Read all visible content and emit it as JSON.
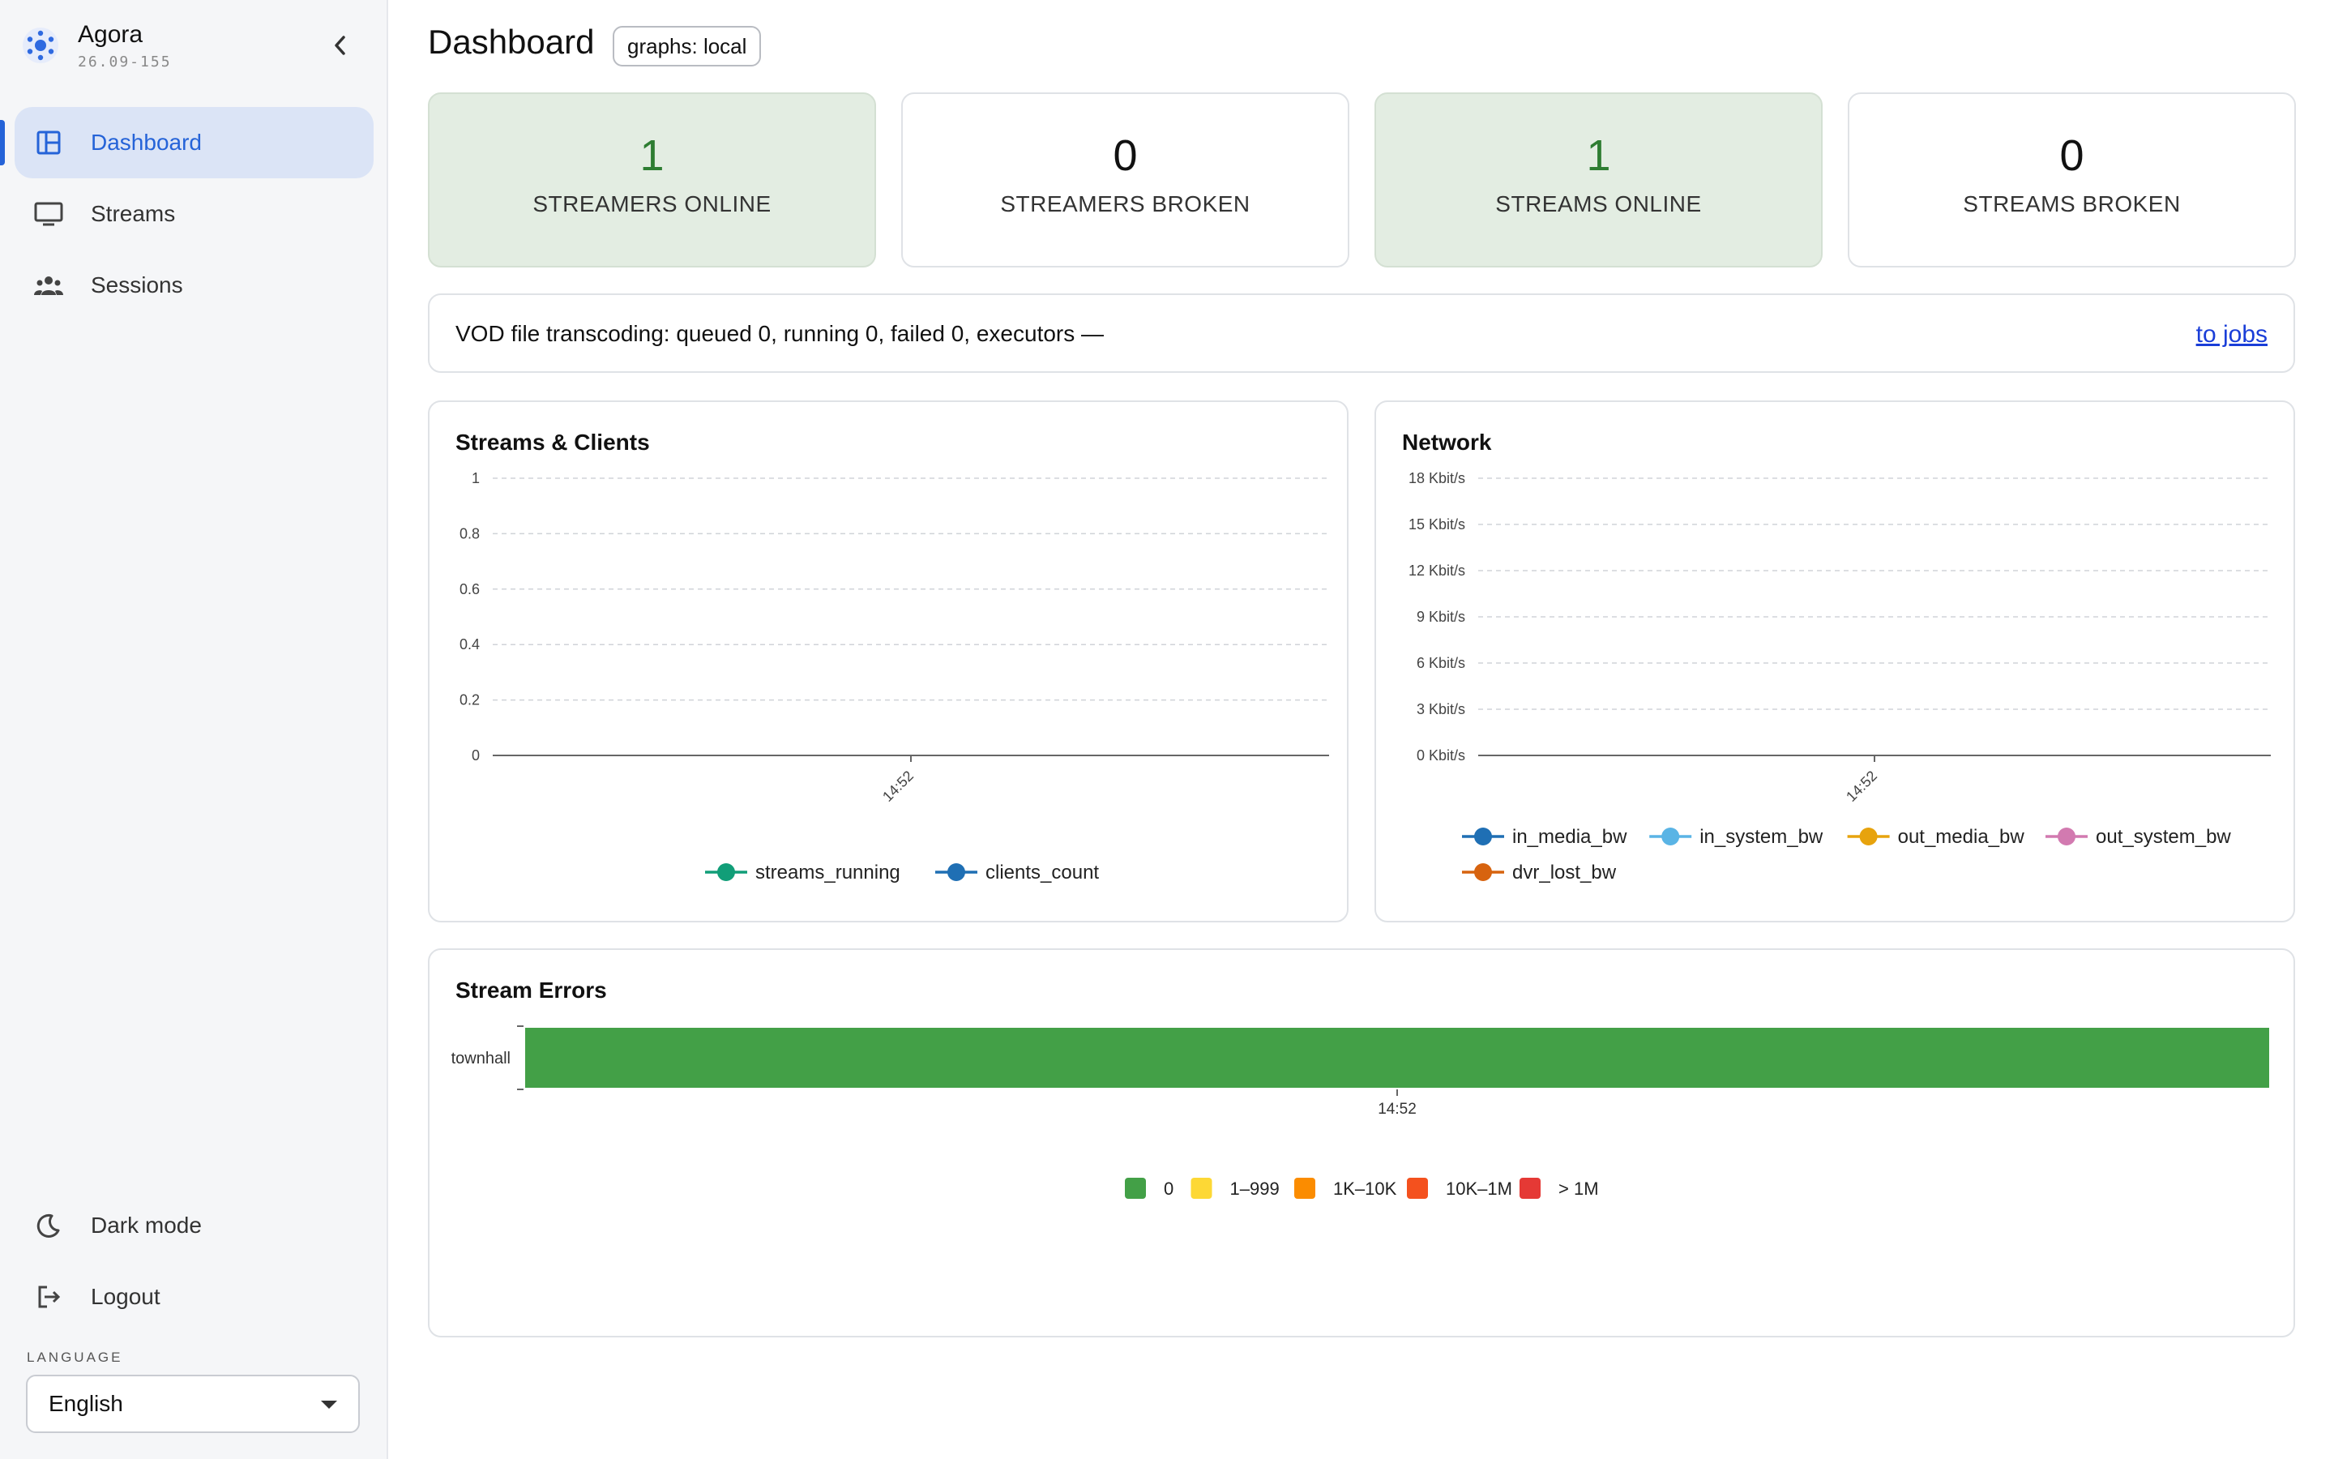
{
  "app": {
    "name": "Agora",
    "version": "26.09-155"
  },
  "sidebar": {
    "items": [
      {
        "label": "Dashboard",
        "icon": "dashboard-icon",
        "active": true
      },
      {
        "label": "Streams",
        "icon": "monitor-icon",
        "active": false
      },
      {
        "label": "Sessions",
        "icon": "people-icon",
        "active": false
      }
    ],
    "dark_mode_label": "Dark mode",
    "logout_label": "Logout",
    "language_label": "LANGUAGE",
    "language_value": "English"
  },
  "header": {
    "title": "Dashboard",
    "badge": "graphs: local"
  },
  "stats": [
    {
      "value": "1",
      "label": "STREAMERS ONLINE",
      "status": "ok"
    },
    {
      "value": "0",
      "label": "STREAMERS BROKEN",
      "status": "neutral"
    },
    {
      "value": "1",
      "label": "STREAMS ONLINE",
      "status": "ok"
    },
    {
      "value": "0",
      "label": "STREAMS BROKEN",
      "status": "neutral"
    }
  ],
  "vod": {
    "text": "VOD file transcoding: queued 0, running 0, failed 0, executors —",
    "link": "to jobs"
  },
  "colors": {
    "accent": "#2563d8",
    "ok_bg": "#e3ede2",
    "ok_text": "#2e7d32"
  },
  "chart_data": [
    {
      "type": "line",
      "title": "Streams & Clients",
      "x": [
        "14:52"
      ],
      "ylim": [
        0,
        1
      ],
      "yticks": [
        "0",
        "0.2",
        "0.4",
        "0.6",
        "0.8",
        "1"
      ],
      "grid": true,
      "legend": "bottom",
      "series": [
        {
          "name": "streams_running",
          "color": "#119e78",
          "values": []
        },
        {
          "name": "clients_count",
          "color": "#1f6fb4",
          "values": []
        }
      ]
    },
    {
      "type": "line",
      "title": "Network",
      "x": [
        "14:52"
      ],
      "ylim": [
        0,
        18
      ],
      "yticks": [
        "0 Kbit/s",
        "3 Kbit/s",
        "6 Kbit/s",
        "9 Kbit/s",
        "12 Kbit/s",
        "15 Kbit/s",
        "18 Kbit/s"
      ],
      "grid": true,
      "legend": "bottom",
      "series": [
        {
          "name": "in_media_bw",
          "color": "#1f6fb4",
          "values": []
        },
        {
          "name": "in_system_bw",
          "color": "#5ab4e5",
          "values": []
        },
        {
          "name": "out_media_bw",
          "color": "#e7a30d",
          "values": []
        },
        {
          "name": "out_system_bw",
          "color": "#d27ab0",
          "values": []
        },
        {
          "name": "dvr_lost_bw",
          "color": "#d7630f",
          "values": []
        }
      ]
    },
    {
      "type": "heatmap",
      "title": "Stream Errors",
      "rows": [
        "townhall"
      ],
      "x": [
        "14:52"
      ],
      "values": [
        [
          0
        ]
      ],
      "legend": "bottom",
      "bins": [
        {
          "label": "0",
          "color": "#43a047"
        },
        {
          "label": "1–999",
          "color": "#fdd835"
        },
        {
          "label": "1K–10K",
          "color": "#fb8c00"
        },
        {
          "label": "10K–1M",
          "color": "#f4511e"
        },
        {
          "label": "> 1M",
          "color": "#e53935"
        }
      ]
    }
  ]
}
